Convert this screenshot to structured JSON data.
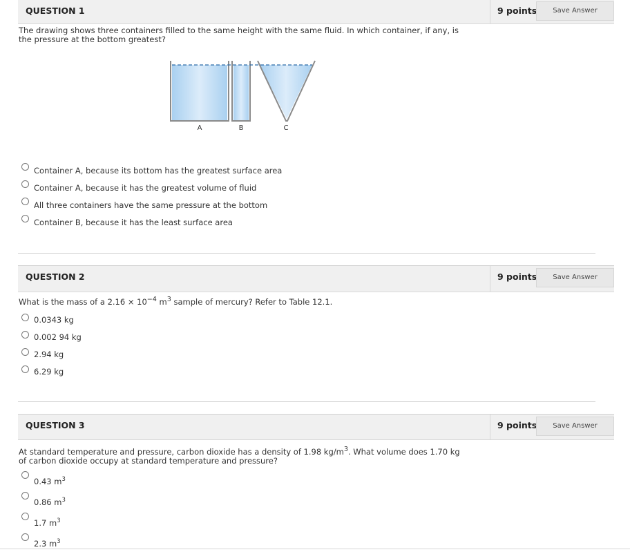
{
  "q1": {
    "title": "QUESTION 1",
    "points": "9 points",
    "save_label": "Save Answer",
    "prompt": "The drawing shows three containers filled to the same height with the same fluid. In which container, if any, is the pressure at the bottom greatest?",
    "figure_labels": [
      "A",
      "B",
      "C"
    ],
    "options": [
      "Container A, because its bottom has the greatest surface area",
      "Container A, because it has the greatest volume of fluid",
      "All three containers have the same pressure at the bottom",
      "Container B, because it has the least surface area"
    ]
  },
  "q2": {
    "title": "QUESTION 2",
    "points": "9 points",
    "save_label": "Save Answer",
    "prompt_pre": "What is the mass of a 2.16 × 10",
    "prompt_exp1": "−4",
    "prompt_mid": " m",
    "prompt_exp2": "3",
    "prompt_post": " sample of mercury? Refer to Table 12.1.",
    "options": [
      "0.0343 kg",
      "0.002 94 kg",
      "2.94 kg",
      "6.29 kg"
    ]
  },
  "q3": {
    "title": "QUESTION 3",
    "points": "9 points",
    "save_label": "Save Answer",
    "prompt_pre": "At standard temperature and pressure, carbon dioxide has a density of 1.98 kg/m",
    "prompt_exp": "3",
    "prompt_post": ". What volume does 1.70 kg of carbon dioxide occupy at standard temperature and pressure?",
    "options": [
      {
        "value": "0.43 m",
        "exp": "3"
      },
      {
        "value": "0.86 m",
        "exp": "3"
      },
      {
        "value": "1.7 m",
        "exp": "3"
      },
      {
        "value": "2.3 m",
        "exp": "3"
      }
    ]
  },
  "colors": {
    "header_bg": "#f0f0f0",
    "fluid": "#bcdcf5",
    "container_border": "#8a8a8a"
  }
}
